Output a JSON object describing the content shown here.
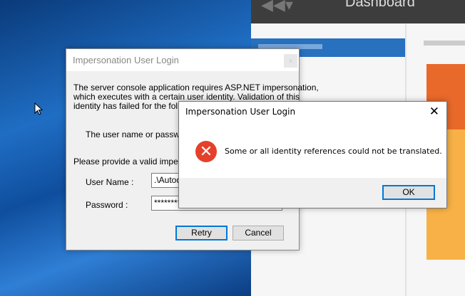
{
  "background_app": {
    "header_title": "Dashboard"
  },
  "back_dialog": {
    "title": "Impersonation User Login",
    "close_label": "x",
    "description_lines": [
      "The server console application requires ASP.NET impersonation,",
      "which executes with a certain user identity.  Validation of this",
      "identity has failed for the followin"
    ],
    "error_line": "The user name or password",
    "prompt": "Please provide a valid imperson",
    "username_label": "User Name :",
    "username_value": ".\\Autod",
    "password_label": "Password :",
    "password_value": "**********",
    "retry_label": "Retry",
    "cancel_label": "Cancel"
  },
  "front_dialog": {
    "title": "Impersonation User Login",
    "close_label": "✕",
    "icon": "error-icon",
    "message": "Some or all identity references could not be translated.",
    "ok_label": "OK"
  },
  "colors": {
    "error": "#e4402a",
    "accent": "#0078d7",
    "tile_orange": "#e8692a",
    "tile_yellow": "#f7b146"
  }
}
